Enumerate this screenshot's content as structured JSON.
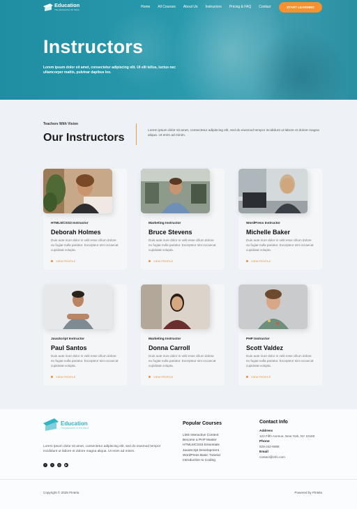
{
  "nav": {
    "brand": "Education",
    "tagline": "The password to the future",
    "links": [
      "Home",
      "All Courses",
      "About Us",
      "Instructors",
      "Pricing & FAQ",
      "Contact"
    ],
    "cta": "START LEARNING"
  },
  "hero": {
    "title": "Instructors",
    "subtitle": "Lorem ipsum dolor sit amet, consectetur adipiscing elit. Ut elit tellus, luctus nec ullamcorper mattis, pulvinar dapibus leo."
  },
  "section": {
    "kicker": "Teachers With Vision",
    "title": "Our Instructors",
    "description": "Lorem ipsum dolor sit amet, consectetur adipiscing elit, sed do eiusmod tempor incididunt ut labore et dolore magna aliqua. Ut enim ad minim."
  },
  "instructors": [
    {
      "role": "HTML5/CSS3 Instructor",
      "name": "Deborah Holmes",
      "bio": "Duis aute irure dolor in velit esse cillum dolore eu fugiat nulla pariatur. Excepteur sint occaecat cupidatat volupta.",
      "link": "VIEW PROFILE"
    },
    {
      "role": "Marketing Instructor",
      "name": "Bruce Stevens",
      "bio": "Duis aute irure dolor in velit esse cillum dolore eu fugiat nulla pariatur. Excepteur sint occaecat cupidatat volupta.",
      "link": "VIEW PROFILE"
    },
    {
      "role": "WordPress Instructor",
      "name": "Michelle Baker",
      "bio": "Duis aute irure dolor in velit esse cillum dolore eu fugiat nulla pariatur. Excepteur sint occaecat cupidatat volupta.",
      "link": "VIEW PROFILE"
    },
    {
      "role": "JavaScript Instructor",
      "name": "Paul Santos",
      "bio": "Duis aute irure dolor in velit esse cillum dolore eu fugiat nulla pariatur. Excepteur sint occaecat cupidatat volupta.",
      "link": "VIEW PROFILE"
    },
    {
      "role": "Marketing Instructor",
      "name": "Donna Carroll",
      "bio": "Duis aute irure dolor in velit esse cillum dolore eu fugiat nulla pariatur. Excepteur sint occaecat cupidatat volupta.",
      "link": "VIEW PROFILE"
    },
    {
      "role": "PHP Instructor",
      "name": "Scott Valdez",
      "bio": "Duis aute irure dolor in velit esse cillum dolore eu fugiat nulla pariatur. Excepteur sint occaecat cupidatat volupta.",
      "link": "VIEW PROFILE"
    }
  ],
  "footer": {
    "brand": "Education",
    "tagline": "The password to the future",
    "description": "Lorem ipsum dolor sit amet, consectetur adipiscing elit, sed do eiusmod tempor incididunt ut labore et dolore magna aliqua. Ut enim ad minim.",
    "social": [
      "facebook-icon",
      "twitter-icon",
      "instagram-icon",
      "youtube-icon"
    ],
    "courses_title": "Popular Courses",
    "courses": [
      "LMS Interactive Content",
      "Become a PHP Master",
      "HTML5/CSS3 Essentials",
      "JavaScript Development",
      "WordPress Basic Tutorial",
      "Introduction to Coding"
    ],
    "contact_title": "Contact Info",
    "address_label": "Address",
    "address": "123 Fifth Avenue, New York, NY 10160",
    "phone_label": "Phone",
    "phone": "929-242-6868",
    "email_label": "Email",
    "email": "contact@info.com",
    "copyright": "Copyright © 2025 Pintela",
    "powered": "Powered by Pintela"
  },
  "colors": {
    "accent": "#f7922f",
    "hero": "#1f8ea3",
    "brand": "#2fb5c4"
  }
}
